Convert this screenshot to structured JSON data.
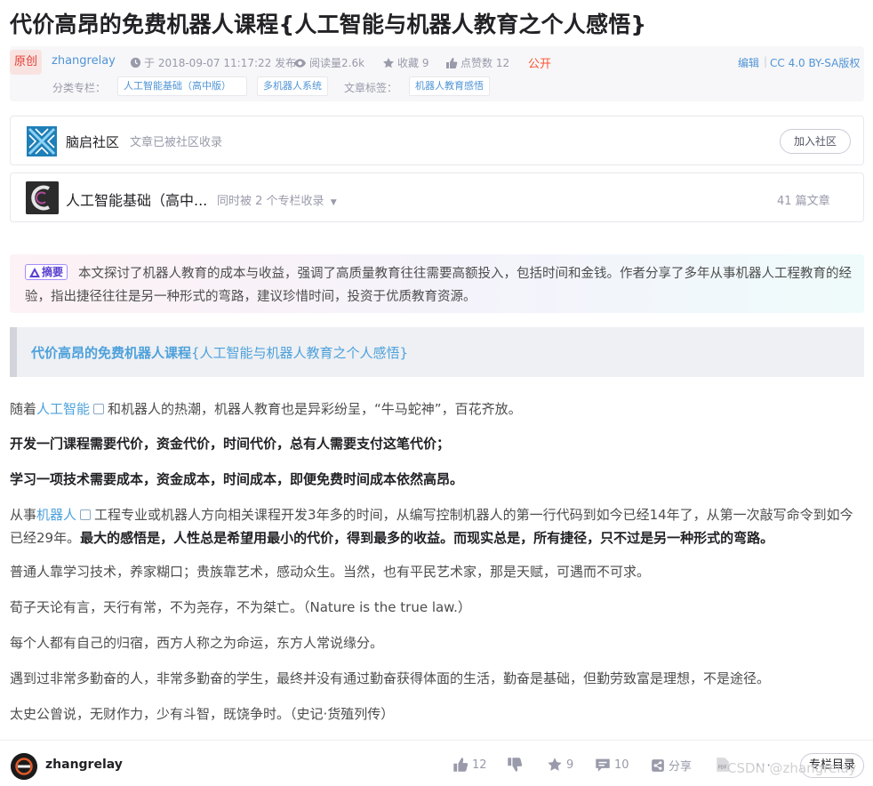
{
  "article": {
    "title": "代价高昂的免费机器人课程{人工智能与机器人教育之个人感悟}"
  },
  "meta": {
    "badge": "原创",
    "author": "zhangrelay",
    "date": "于 2018-09-07 11:17:22 发布",
    "reads": "阅读量2.6k",
    "favorites": "收藏 9",
    "likes": "点赞数 12",
    "visibility": "公开",
    "edit": "编辑",
    "license": "CC 4.0 BY-SA版权",
    "column_label": "分类专栏：",
    "columns": [
      "人工智能基础（高中版）",
      "多机器人系统"
    ],
    "tags_label": "文章标签：",
    "tags": [
      "机器人教育感悟"
    ]
  },
  "community": {
    "name": "脑启社区",
    "note": "文章已被社区收录",
    "join": "加入社区"
  },
  "column": {
    "name": "人工智能基础（高中...",
    "sub": "同时被 2 个专栏收录",
    "count": "41 篇文章"
  },
  "summary": {
    "tag": "摘要",
    "text": "本文探讨了机器人教育的成本与收益，强调了高质量教育往往需要高额投入，包括时间和金钱。作者分享了多年从事机器人工程教育的经验，指出捷径往往是另一种形式的弯路，建议珍惜时间，投资于优质教育资源。"
  },
  "quote": {
    "bold": "代价高昂的免费机器人课程",
    "rest": "{人工智能与机器人教育之个人感悟}"
  },
  "body": {
    "p1_a": "随着",
    "p1_link": "人工智能",
    "p1_b": "和机器人的热潮，机器人教育也是异彩纷呈，“牛马蛇神”，百花齐放。",
    "p2": "开发一门课程需要代价，资金代价，时间代价，总有人需要支付这笔代价；",
    "p3": "学习一项技术需要成本，资金成本，时间成本，即便免费时间成本依然高昂。",
    "p4_a": "从事",
    "p4_link": "机器人",
    "p4_b": "工程专业或机器人方向相关课程开发3年多的时间，从编写控制机器人的第一行代码到如今已经14年了，从第一次敲写命令到如今已经29年。",
    "p4_strong": "最大的感悟是，人性总是希望用最小的代价，得到最多的收益。而现实总是，所有捷径，只不过是另一种形式的弯路。",
    "p5": "普通人靠学习技术，养家糊口；贵族靠艺术，感动众生。当然，也有平民艺术家，那是天赋，可遇而不可求。",
    "p6": "荀子天论有言，天行有常，不为尧存，不为桀亡。（Nature is the true law.）",
    "p7": "每个人都有自己的归宿，西方人称之为命运，东方人常说缘分。",
    "p8": "遇到过非常多勤奋的人，非常多勤奋的学生，最终并没有通过勤奋获得体面的生活，勤奋是基础，但勤劳致富是理想，不是途径。",
    "p9": "太史公曾说，无财作力，少有斗智，既饶争时。（史记·货殖列传）"
  },
  "bottom_bar": {
    "author": "zhangrelay",
    "likes": "12",
    "favorites": "9",
    "comments": "10",
    "share": "分享",
    "column_button": "专栏目录",
    "watermark": "CSDN @zhangrelay"
  },
  "colors": {
    "link": "#4ea1db",
    "accent": "#fc5531",
    "meta_link": "#5094d5"
  }
}
